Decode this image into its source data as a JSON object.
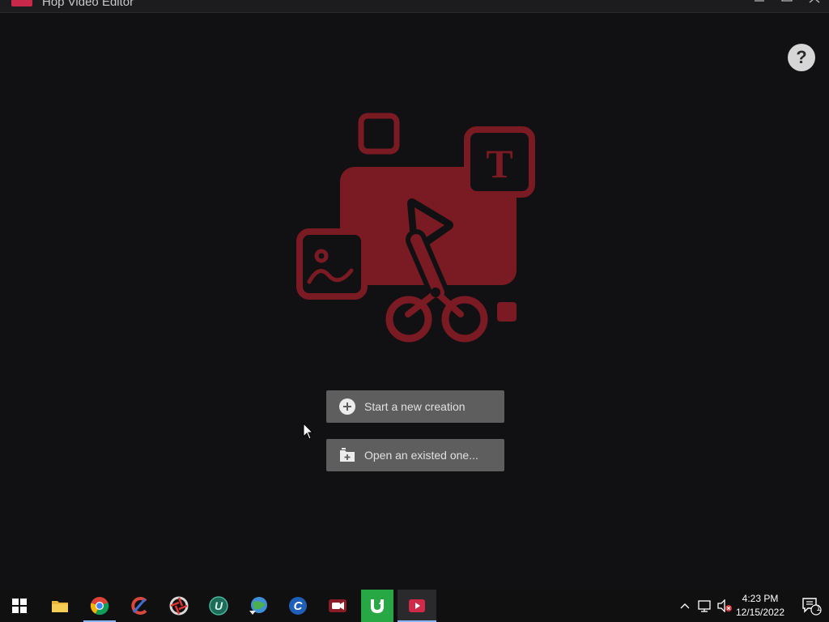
{
  "window": {
    "title": "Hop Video Editor",
    "accent_color": "#c8284a"
  },
  "main": {
    "help_label": "?",
    "hero_icon": "video-editor-illustration-icon",
    "hero_color": "#7a1a22",
    "actions": [
      {
        "label": "Start a new creation",
        "icon": "plus-circle-icon"
      },
      {
        "label": "Open an existed one...",
        "icon": "folder-add-icon"
      }
    ]
  },
  "taskbar": {
    "apps": [
      {
        "name": "start",
        "icon": "windows-start-icon"
      },
      {
        "name": "file-explorer",
        "icon": "folder-icon"
      },
      {
        "name": "chrome",
        "icon": "chrome-icon"
      },
      {
        "name": "ccleaner",
        "icon": "ccleaner-icon"
      },
      {
        "name": "app-5",
        "icon": "aperture-icon"
      },
      {
        "name": "uget",
        "icon": "u-circle-icon"
      },
      {
        "name": "internet-download-manager",
        "icon": "globe-download-icon"
      },
      {
        "name": "app-8",
        "icon": "c-circle-icon"
      },
      {
        "name": "screen-recorder",
        "icon": "video-camera-icon"
      },
      {
        "name": "utorrent",
        "icon": "utorrent-icon"
      },
      {
        "name": "hop-video-editor",
        "icon": "video-editor-icon"
      }
    ],
    "clock": {
      "time": "4:23 PM",
      "date": "12/15/2022"
    },
    "notification_count": "1"
  }
}
